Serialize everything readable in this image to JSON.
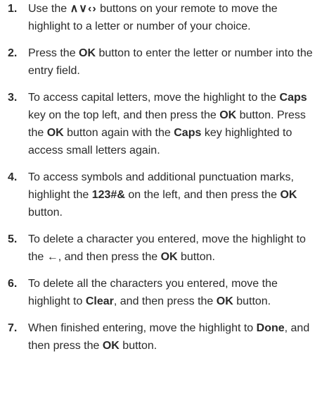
{
  "steps": [
    {
      "num": "1.",
      "parts": [
        {
          "text": "Use the ",
          "bold": false
        },
        {
          "text": "∧∨‹›",
          "bold": true,
          "arrows": true
        },
        {
          "text": " buttons on your remote to move the highlight to a letter or number of your choice.",
          "bold": false
        }
      ]
    },
    {
      "num": "2.",
      "parts": [
        {
          "text": "Press the ",
          "bold": false
        },
        {
          "text": "OK",
          "bold": true
        },
        {
          "text": " button to enter the letter or number into the entry field.",
          "bold": false
        }
      ]
    },
    {
      "num": "3.",
      "parts": [
        {
          "text": "To access capital letters, move the highlight to the ",
          "bold": false
        },
        {
          "text": "Caps",
          "bold": true
        },
        {
          "text": " key on the top left, and then press the ",
          "bold": false
        },
        {
          "text": "OK",
          "bold": true
        },
        {
          "text": " button. Press the ",
          "bold": false
        },
        {
          "text": "OK",
          "bold": true
        },
        {
          "text": " button again with the ",
          "bold": false
        },
        {
          "text": "Caps",
          "bold": true
        },
        {
          "text": " key highlighted to access small letters again.",
          "bold": false
        }
      ]
    },
    {
      "num": "4.",
      "parts": [
        {
          "text": "To access symbols and additional punctuation marks, highlight the ",
          "bold": false
        },
        {
          "text": "123#&",
          "bold": true
        },
        {
          "text": " on the left, and then press the ",
          "bold": false
        },
        {
          "text": "OK",
          "bold": true
        },
        {
          "text": " button.",
          "bold": false
        }
      ]
    },
    {
      "num": "5.",
      "parts": [
        {
          "text": "To delete a character you entered, move the highlight to the ",
          "bold": false
        },
        {
          "text": "←",
          "bold": true
        },
        {
          "text": ", and then press the ",
          "bold": false
        },
        {
          "text": "OK",
          "bold": true
        },
        {
          "text": " button.",
          "bold": false
        }
      ]
    },
    {
      "num": "6.",
      "parts": [
        {
          "text": "To delete all the characters you entered, move the highlight to ",
          "bold": false
        },
        {
          "text": "Clear",
          "bold": true
        },
        {
          "text": ", and then press the ",
          "bold": false
        },
        {
          "text": "OK",
          "bold": true
        },
        {
          "text": " button.",
          "bold": false
        }
      ]
    },
    {
      "num": "7.",
      "parts": [
        {
          "text": "When finished entering, move the highlight to ",
          "bold": false
        },
        {
          "text": "Done",
          "bold": true
        },
        {
          "text": ", and then press the ",
          "bold": false
        },
        {
          "text": "OK",
          "bold": true
        },
        {
          "text": " button.",
          "bold": false
        }
      ]
    }
  ]
}
